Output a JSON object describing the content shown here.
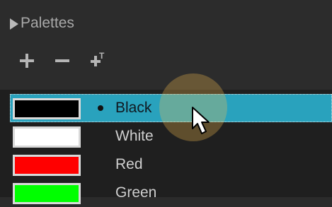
{
  "panel": {
    "title": "Palettes"
  },
  "toolbar": {
    "add_icon": "plus-icon",
    "remove_icon": "minus-icon",
    "rename_icon": "add-text-icon",
    "rename_label": "T"
  },
  "palettes": [
    {
      "name": "Black",
      "color": "#000000",
      "selected": true
    },
    {
      "name": "White",
      "color": "#ffffff",
      "selected": false
    },
    {
      "name": "Red",
      "color": "#ff0000",
      "selected": false
    },
    {
      "name": "Green",
      "color": "#00ff00",
      "selected": false
    }
  ],
  "colors": {
    "selection": "#29a2bd",
    "background": "#2c2c2c"
  }
}
